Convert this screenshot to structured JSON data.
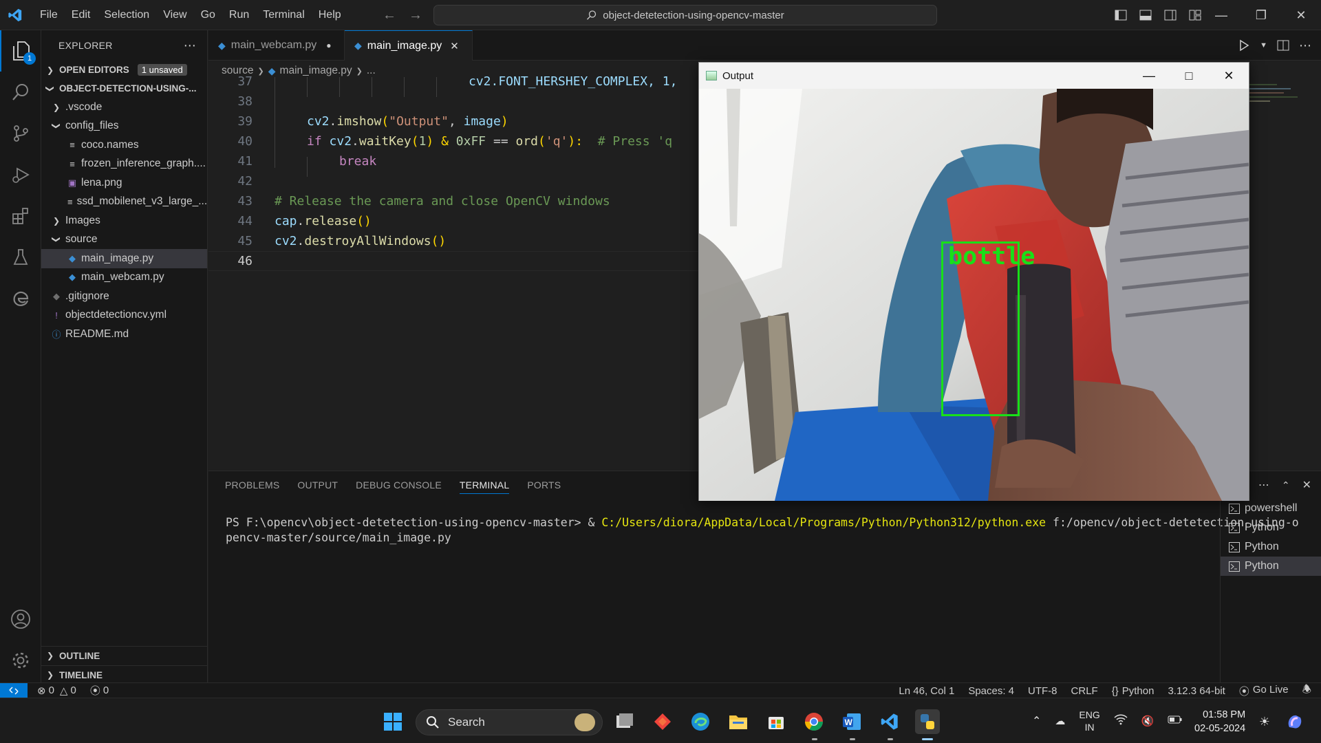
{
  "titlebar": {
    "menu": [
      "File",
      "Edit",
      "Selection",
      "View",
      "Go",
      "Run",
      "Terminal",
      "Help"
    ],
    "command_center": "object-detetection-using-opencv-master"
  },
  "activity": {
    "explorer_badge": "1"
  },
  "sidebar": {
    "title": "EXPLORER",
    "open_editors": "OPEN EDITORS",
    "unsaved": "1 unsaved",
    "project": "OBJECT-DETECTION-USING-...",
    "tree": [
      {
        "label": ".vscode",
        "kind": "folder-closed",
        "indent": 1
      },
      {
        "label": "config_files",
        "kind": "folder-open",
        "indent": 1
      },
      {
        "label": "coco.names",
        "kind": "text",
        "indent": 2
      },
      {
        "label": "frozen_inference_graph....",
        "kind": "text",
        "indent": 2
      },
      {
        "label": "lena.png",
        "kind": "image",
        "indent": 2
      },
      {
        "label": "ssd_mobilenet_v3_large_...",
        "kind": "text",
        "indent": 2
      },
      {
        "label": "Images",
        "kind": "folder-closed",
        "indent": 1
      },
      {
        "label": "source",
        "kind": "folder-open",
        "indent": 1
      },
      {
        "label": "main_image.py",
        "kind": "python",
        "indent": 2,
        "selected": true
      },
      {
        "label": "main_webcam.py",
        "kind": "python",
        "indent": 2
      },
      {
        "label": ".gitignore",
        "kind": "git",
        "indent": 1
      },
      {
        "label": "objectdetectioncv.yml",
        "kind": "yaml",
        "indent": 1
      },
      {
        "label": "README.md",
        "kind": "info",
        "indent": 1
      }
    ],
    "outline": "OUTLINE",
    "timeline": "TIMELINE"
  },
  "tabs": [
    {
      "label": "main_webcam.py",
      "modified": true,
      "active": false
    },
    {
      "label": "main_image.py",
      "modified": false,
      "active": true
    }
  ],
  "breadcrumb": {
    "folder": "source",
    "file": "main_image.py",
    "more": "..."
  },
  "code": {
    "line_numbers": [
      "37",
      "38",
      "39",
      "40",
      "41",
      "42",
      "43",
      "44",
      "45",
      "46"
    ],
    "l37": "cv2.FONT_HERSHEY_COMPLEX, 1,",
    "l39_a": "cv2",
    "l39_b": ".",
    "l39_c": "imshow",
    "l39_d": "(",
    "l39_e": "\"Output\"",
    "l39_f": ", ",
    "l39_g": "image",
    "l39_h": ")",
    "l40_a": "if ",
    "l40_b": "cv2",
    "l40_c": ".",
    "l40_d": "waitKey",
    "l40_e": "(",
    "l40_f": "1",
    "l40_g": ") & ",
    "l40_h": "0xFF",
    "l40_i": " == ",
    "l40_j": "ord",
    "l40_k": "(",
    "l40_l": "'q'",
    "l40_m": "):  ",
    "l40_n": "# Press 'q",
    "l41": "break",
    "l43": "# Release the camera and close OpenCV windows",
    "l44_a": "cap",
    "l44_b": ".",
    "l44_c": "release",
    "l44_d": "()",
    "l45_a": "cv2",
    "l45_b": ".",
    "l45_c": "destroyAllWindows",
    "l45_d": "()"
  },
  "panel": {
    "tabs": [
      "PROBLEMS",
      "OUTPUT",
      "DEBUG CONSOLE",
      "TERMINAL",
      "PORTS"
    ],
    "active_tab": "TERMINAL",
    "prompt": "PS F:\\opencv\\object-detetection-using-opencv-master> & ",
    "exe": "C:/Users/diora/AppData/Local/Programs/Python/Python312/python.exe",
    "args_1": " f:/opencv/object-detetection-using-o",
    "args_2": "pencv-master/source/main_image.py",
    "terminals": [
      {
        "label": "powershell",
        "selected": false
      },
      {
        "label": "Python",
        "selected": false
      },
      {
        "label": "Python",
        "selected": false
      },
      {
        "label": "Python",
        "selected": true
      }
    ]
  },
  "output_window": {
    "title": "Output",
    "detection_label": "bottle",
    "box_color": "#18e018"
  },
  "statusbar": {
    "errors": "0",
    "warnings": "0",
    "ports": "0",
    "position": "Ln 46, Col 1",
    "spaces": "Spaces: 4",
    "encoding": "UTF-8",
    "eol": "CRLF",
    "language": "Python",
    "interpreter": "3.12.3 64-bit",
    "golive": "Go Live"
  },
  "taskbar": {
    "search": "Search",
    "lang_1": "ENG",
    "lang_2": "IN",
    "time": "01:58 PM",
    "date": "02-05-2024"
  },
  "colors": {
    "accent": "#0078d4",
    "editor_bg": "#1f1f1f",
    "sidebar_bg": "#181818"
  }
}
